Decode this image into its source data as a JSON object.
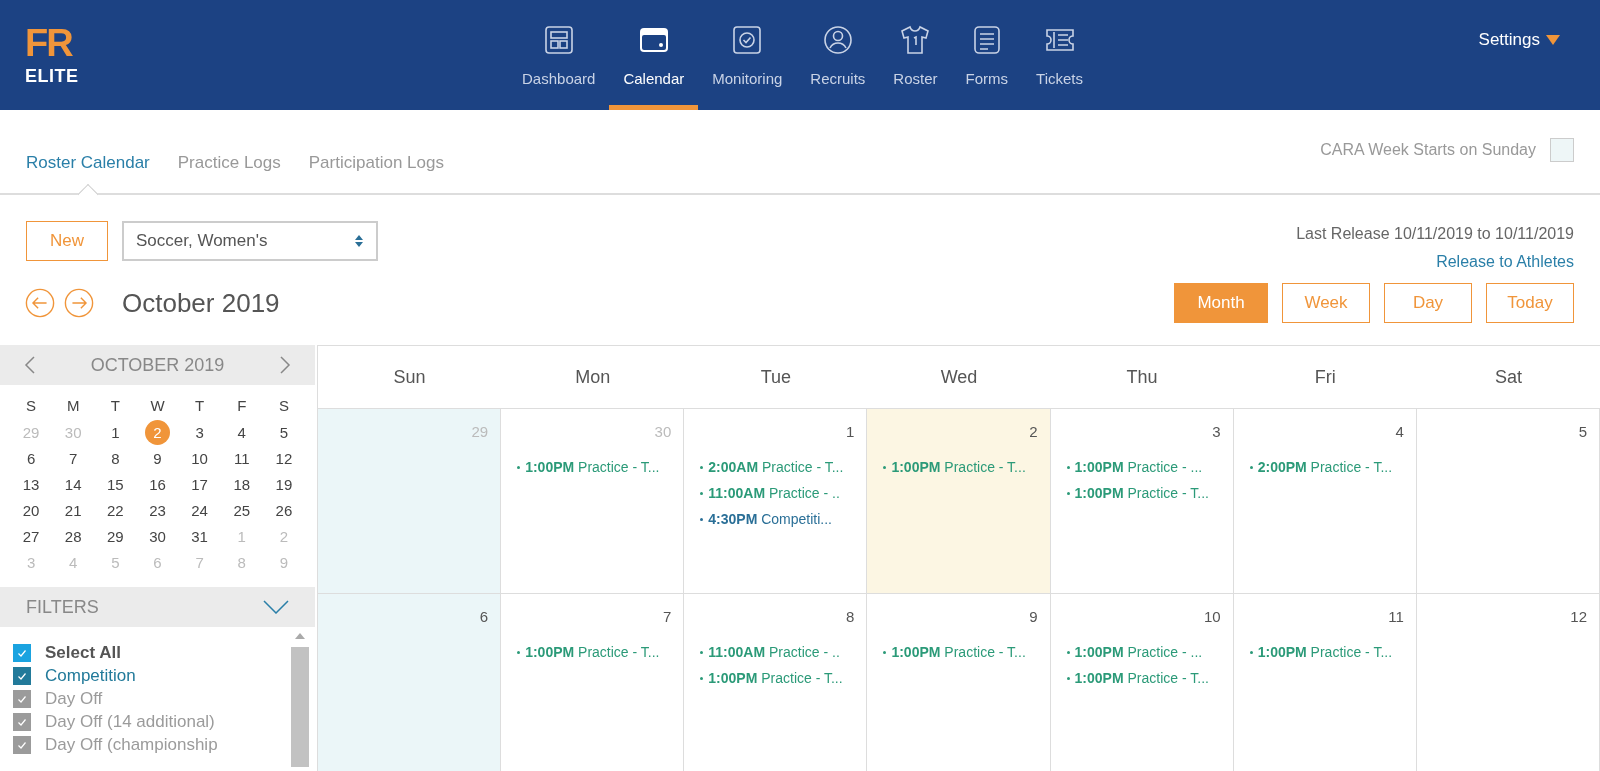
{
  "logo": {
    "mark": "FR",
    "name": "ELITE"
  },
  "nav": [
    {
      "label": "Dashboard",
      "selected": false
    },
    {
      "label": "Calendar",
      "selected": true
    },
    {
      "label": "Monitoring",
      "selected": false
    },
    {
      "label": "Recruits",
      "selected": false
    },
    {
      "label": "Roster",
      "selected": false
    },
    {
      "label": "Forms",
      "selected": false
    },
    {
      "label": "Tickets",
      "selected": false
    }
  ],
  "settings": {
    "label": "Settings"
  },
  "subtabs": [
    {
      "label": "Roster Calendar",
      "selected": true
    },
    {
      "label": "Practice Logs",
      "selected": false
    },
    {
      "label": "Participation Logs",
      "selected": false
    }
  ],
  "week_option": {
    "label": "CARA Week Starts on Sunday",
    "checked": false
  },
  "new_button": "New",
  "sport_select": {
    "value": "Soccer, Women's"
  },
  "last_release": "Last Release 10/11/2019 to 10/11/2019",
  "release_link": "Release to Athletes",
  "period": "October 2019",
  "views": [
    {
      "label": "Month",
      "selected": true
    },
    {
      "label": "Week",
      "selected": false
    },
    {
      "label": "Day",
      "selected": false
    },
    {
      "label": "Today",
      "selected": false
    }
  ],
  "mini_calendar": {
    "title": "OCTOBER 2019",
    "weekdays": [
      "S",
      "M",
      "T",
      "W",
      "T",
      "F",
      "S"
    ],
    "weeks": [
      [
        {
          "d": "29",
          "muted": true,
          "selected": false
        },
        {
          "d": "30",
          "muted": true,
          "selected": false
        },
        {
          "d": "1",
          "muted": false,
          "selected": false
        },
        {
          "d": "2",
          "muted": false,
          "selected": true
        },
        {
          "d": "3",
          "muted": false,
          "selected": false
        },
        {
          "d": "4",
          "muted": false,
          "selected": false
        },
        {
          "d": "5",
          "muted": false,
          "selected": false
        }
      ],
      [
        {
          "d": "6",
          "muted": false,
          "selected": false
        },
        {
          "d": "7",
          "muted": false,
          "selected": false
        },
        {
          "d": "8",
          "muted": false,
          "selected": false
        },
        {
          "d": "9",
          "muted": false,
          "selected": false
        },
        {
          "d": "10",
          "muted": false,
          "selected": false
        },
        {
          "d": "11",
          "muted": false,
          "selected": false
        },
        {
          "d": "12",
          "muted": false,
          "selected": false
        }
      ],
      [
        {
          "d": "13",
          "muted": false,
          "selected": false
        },
        {
          "d": "14",
          "muted": false,
          "selected": false
        },
        {
          "d": "15",
          "muted": false,
          "selected": false
        },
        {
          "d": "16",
          "muted": false,
          "selected": false
        },
        {
          "d": "17",
          "muted": false,
          "selected": false
        },
        {
          "d": "18",
          "muted": false,
          "selected": false
        },
        {
          "d": "19",
          "muted": false,
          "selected": false
        }
      ],
      [
        {
          "d": "20",
          "muted": false,
          "selected": false
        },
        {
          "d": "21",
          "muted": false,
          "selected": false
        },
        {
          "d": "22",
          "muted": false,
          "selected": false
        },
        {
          "d": "23",
          "muted": false,
          "selected": false
        },
        {
          "d": "24",
          "muted": false,
          "selected": false
        },
        {
          "d": "25",
          "muted": false,
          "selected": false
        },
        {
          "d": "26",
          "muted": false,
          "selected": false
        }
      ],
      [
        {
          "d": "27",
          "muted": false,
          "selected": false
        },
        {
          "d": "28",
          "muted": false,
          "selected": false
        },
        {
          "d": "29",
          "muted": false,
          "selected": false
        },
        {
          "d": "30",
          "muted": false,
          "selected": false
        },
        {
          "d": "31",
          "muted": false,
          "selected": false
        },
        {
          "d": "1",
          "muted": true,
          "selected": false
        },
        {
          "d": "2",
          "muted": true,
          "selected": false
        }
      ],
      [
        {
          "d": "3",
          "muted": true,
          "selected": false
        },
        {
          "d": "4",
          "muted": true,
          "selected": false
        },
        {
          "d": "5",
          "muted": true,
          "selected": false
        },
        {
          "d": "6",
          "muted": true,
          "selected": false
        },
        {
          "d": "7",
          "muted": true,
          "selected": false
        },
        {
          "d": "8",
          "muted": true,
          "selected": false
        },
        {
          "d": "9",
          "muted": true,
          "selected": false
        }
      ]
    ]
  },
  "filters": {
    "title": "FILTERS",
    "items": [
      {
        "label": "Select All",
        "kind": "all",
        "checked": true,
        "color": "#1aa3e0"
      },
      {
        "label": "Competition",
        "kind": "type",
        "checked": true,
        "color": "#227a9a"
      },
      {
        "label": "Day Off",
        "kind": "type",
        "checked": true,
        "color": "#9b9b9b"
      },
      {
        "label": "Day Off (14 additional)",
        "kind": "type",
        "checked": true,
        "color": "#9b9b9b"
      },
      {
        "label": "Day Off (championship",
        "kind": "type",
        "checked": true,
        "color": "#9b9b9b"
      }
    ]
  },
  "calendar": {
    "weekdays": [
      "Sun",
      "Mon",
      "Tue",
      "Wed",
      "Thu",
      "Fri",
      "Sat"
    ],
    "weeks": [
      [
        {
          "day": "29",
          "muted": true,
          "today": false
        },
        {
          "day": "30",
          "muted": true,
          "today": false,
          "events": [
            {
              "kind": "practice",
              "text": "**1:00PM** Practice - T..."
            }
          ]
        },
        {
          "day": "1",
          "muted": false,
          "today": false,
          "events": [
            {
              "kind": "practice",
              "text": "**2:00AM** Practice - T..."
            },
            {
              "kind": "practice",
              "text": "**11:00AM** Practice - .."
            },
            {
              "kind": "competition",
              "text": "**4:30PM** Competiti..."
            }
          ]
        },
        {
          "day": "2",
          "muted": false,
          "today": true,
          "events": [
            {
              "kind": "practice",
              "text": "**1:00PM** Practice - T..."
            }
          ]
        },
        {
          "day": "3",
          "muted": false,
          "today": false,
          "events": [
            {
              "kind": "practice",
              "text": "**1:00PM** Practice - ..."
            },
            {
              "kind": "practice",
              "text": "**1:00PM** Practice - T..."
            }
          ]
        },
        {
          "day": "4",
          "muted": false,
          "today": false,
          "events": [
            {
              "kind": "practice",
              "text": "**2:00PM** Practice - T..."
            }
          ]
        },
        {
          "day": "5",
          "muted": false,
          "today": false
        }
      ],
      [
        {
          "day": "6",
          "muted": false,
          "today": false
        },
        {
          "day": "7",
          "muted": false,
          "today": false,
          "events": [
            {
              "kind": "practice",
              "text": "**1:00PM** Practice - T..."
            }
          ]
        },
        {
          "day": "8",
          "muted": false,
          "today": false,
          "events": [
            {
              "kind": "practice",
              "text": "**11:00AM** Practice - .."
            },
            {
              "kind": "practice",
              "text": "**1:00PM** Practice - T..."
            }
          ]
        },
        {
          "day": "9",
          "muted": false,
          "today": false,
          "events": [
            {
              "kind": "practice",
              "text": "**1:00PM** Practice - T..."
            }
          ]
        },
        {
          "day": "10",
          "muted": false,
          "today": false,
          "events": [
            {
              "kind": "practice",
              "text": "**1:00PM** Practice - ..."
            },
            {
              "kind": "practice",
              "text": "**1:00PM** Practice - T..."
            }
          ]
        },
        {
          "day": "11",
          "muted": false,
          "today": false,
          "events": [
            {
              "kind": "practice",
              "text": "**1:00PM** Practice - T..."
            }
          ]
        },
        {
          "day": "12",
          "muted": false,
          "today": false
        }
      ]
    ]
  }
}
